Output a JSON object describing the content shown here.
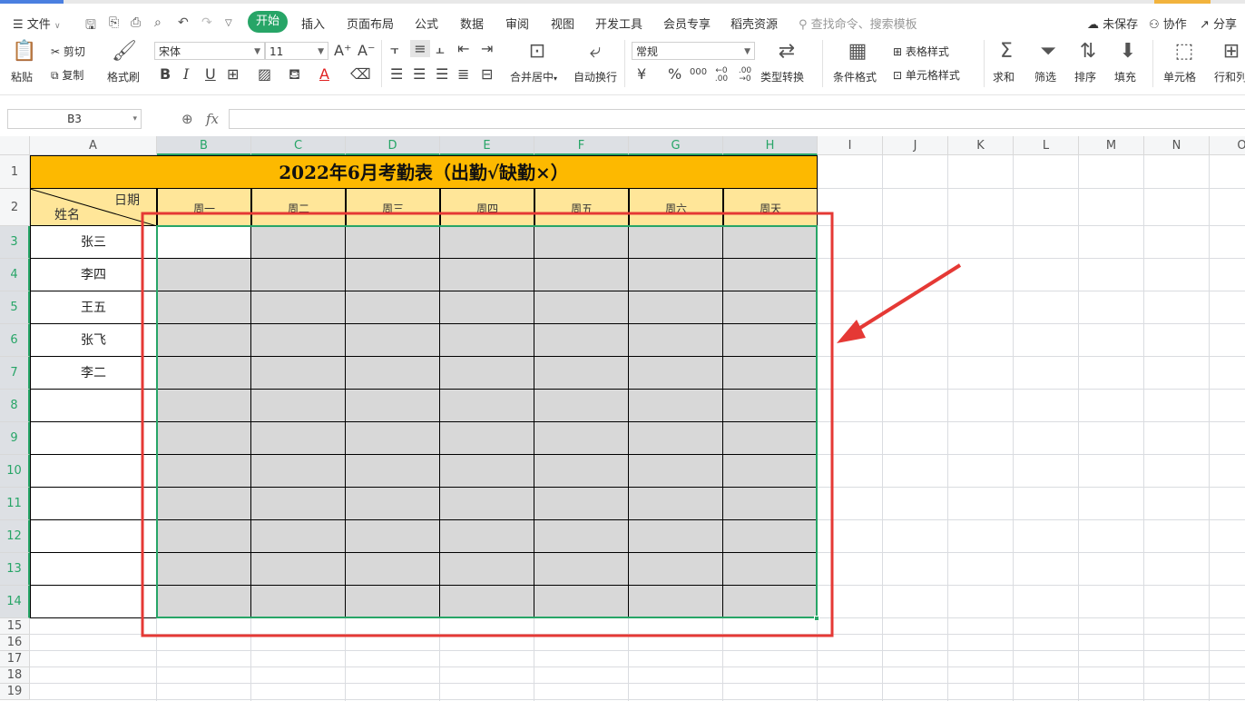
{
  "menu": {
    "file_label": "文件",
    "tabs": [
      "开始",
      "插入",
      "页面布局",
      "公式",
      "数据",
      "审阅",
      "视图",
      "开发工具",
      "会员专享",
      "稻壳资源"
    ],
    "search_placeholder": "查找命令、搜索模板",
    "unsaved_label": "未保存",
    "collab_label": "协作",
    "share_label": "分享"
  },
  "ribbon": {
    "paste": "粘贴",
    "cut": "剪切",
    "copy": "复制",
    "format_painter": "格式刷",
    "font_name": "宋体",
    "font_size": "11",
    "bold": "B",
    "italic": "I",
    "underline": "U",
    "merge_center": "合并居中",
    "wrap_text": "自动换行",
    "number_format": "常规",
    "currency": "¥",
    "percent": "%",
    "thousands": "000",
    "dec_increase": "←0 .00",
    "dec_decrease": ".00 →0",
    "type_convert": "类型转换",
    "conditional_format": "条件格式",
    "table_style": "表格样式",
    "cell_style": "单元格样式",
    "sum": "求和",
    "filter": "筛选",
    "sort": "排序",
    "fill": "填充",
    "cell": "单元格",
    "row_col": "行和列"
  },
  "formula_bar": {
    "name_box": "B3",
    "fx": "fx",
    "value": ""
  },
  "columns": [
    "A",
    "B",
    "C",
    "D",
    "E",
    "F",
    "G",
    "H",
    "I",
    "J",
    "K",
    "L",
    "M",
    "N",
    "O"
  ],
  "rows": [
    "1",
    "2",
    "3",
    "4",
    "5",
    "6",
    "7",
    "8",
    "9",
    "10",
    "11",
    "12",
    "13",
    "14",
    "15",
    "16",
    "17",
    "18",
    "19"
  ],
  "sheet": {
    "title": "2022年6月考勤表（出勤√缺勤×）",
    "corner_top": "日期",
    "corner_bottom": "姓名",
    "days": [
      "周一",
      "周二",
      "周三",
      "周四",
      "周五",
      "周六",
      "周天"
    ],
    "names": [
      "张三",
      "李四",
      "王五",
      "张飞",
      "李二",
      "",
      "",
      "",
      "",
      "",
      "",
      ""
    ]
  },
  "colors": {
    "accent_green": "#27a567",
    "title_fill": "#fdb900",
    "header_fill": "#ffe699",
    "selection_fill": "#d8d8d8",
    "annotation_red": "#e53935"
  }
}
